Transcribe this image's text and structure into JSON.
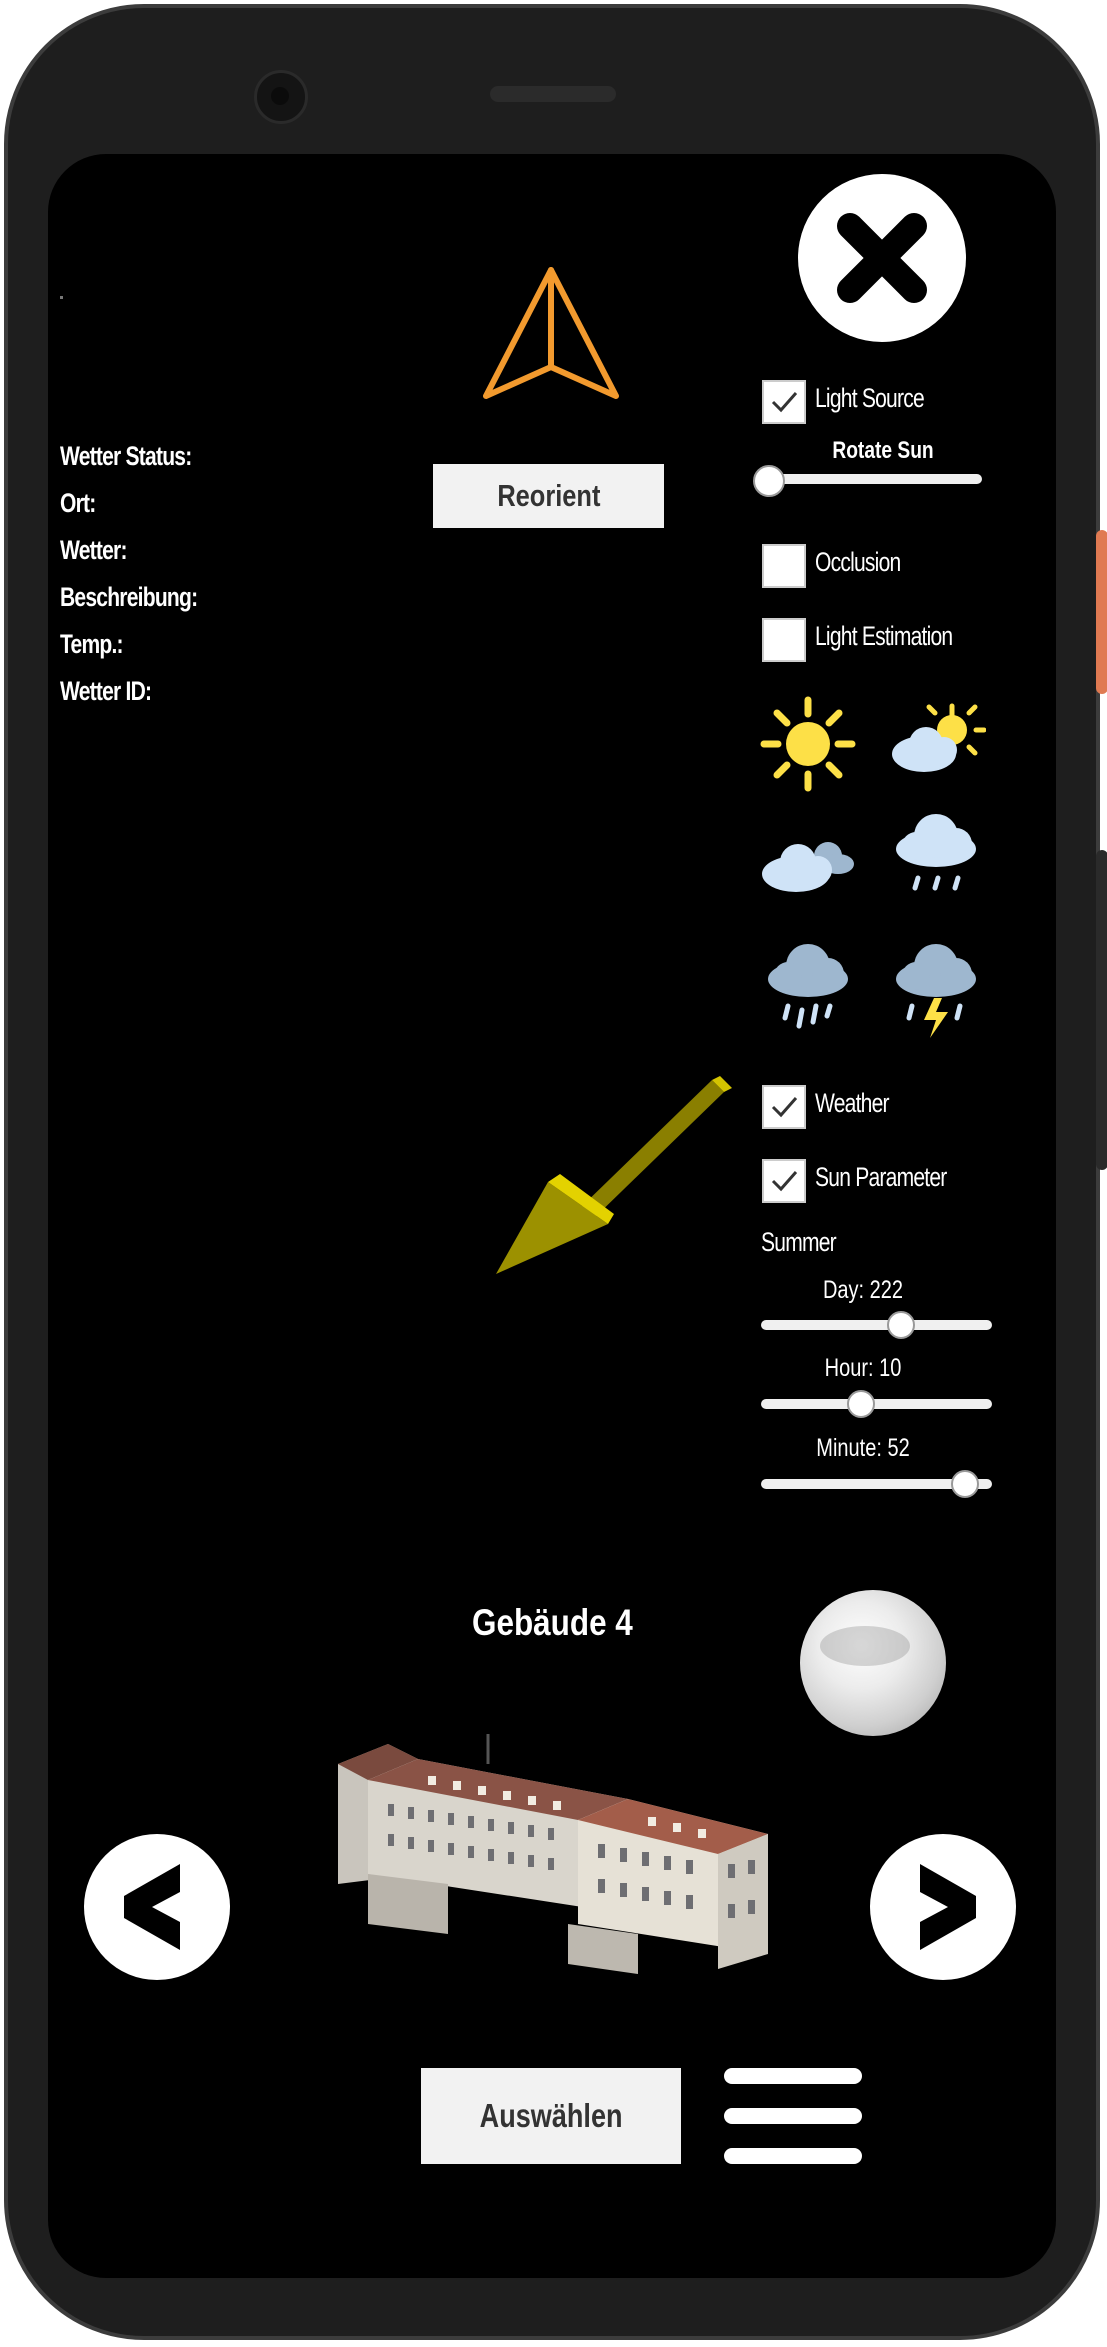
{
  "info": {
    "labels": [
      "Wetter Status:",
      "Ort:",
      "Wetter:",
      "Beschreibung:",
      "Temp.:",
      "Wetter ID:"
    ]
  },
  "reorient_label": "Reorient",
  "toggles": {
    "light_source": "Light Source",
    "rotate_sun": "Rotate Sun",
    "occlusion": "Occlusion",
    "light_estimation": "Light Estimation",
    "weather": "Weather",
    "sun_parameter": "Sun Parameter"
  },
  "season": "Summer",
  "sliders": {
    "day": {
      "label": "Day: 222",
      "value": 222,
      "max": 365
    },
    "hour": {
      "label": "Hour: 10",
      "value": 10,
      "max": 23
    },
    "minute": {
      "label": "Minute: 52",
      "value": 52,
      "max": 59
    },
    "rotate_sun_value": 0
  },
  "building_title": "Gebäude 4",
  "select_label": "Auswählen",
  "weather_icons": [
    "sun-icon",
    "partly-cloudy-icon",
    "cloudy-icon",
    "light-rain-icon",
    "rain-icon",
    "thunderstorm-icon"
  ],
  "colors": {
    "compass_orange": "#f29a2e",
    "arrow_yellow": "#c9b800",
    "sun_yellow": "#fde047",
    "cloud_blue": "#cfe3f7",
    "rain_cloud": "#9eb7cf",
    "side_button": "#e07a52"
  }
}
